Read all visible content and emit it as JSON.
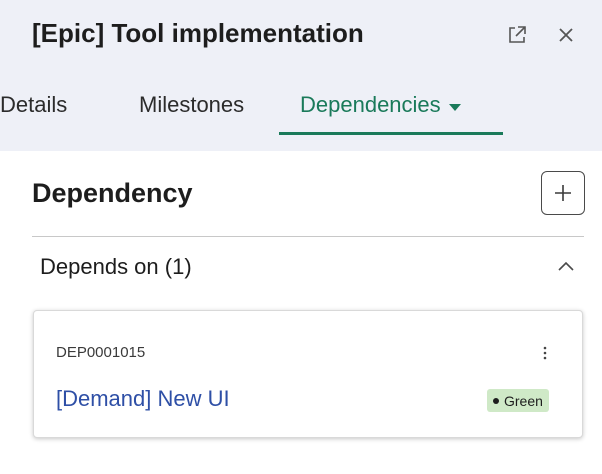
{
  "header": {
    "title": "[Epic] Tool implementation",
    "open_new_window_icon": "external-link-icon",
    "close_icon": "close-icon"
  },
  "tabs": [
    {
      "label": "Details",
      "active": false
    },
    {
      "label": "Milestones",
      "active": false
    },
    {
      "label": "Dependencies",
      "active": true,
      "has_dropdown": true
    }
  ],
  "section": {
    "title": "Dependency",
    "add_icon": "plus-icon"
  },
  "group": {
    "label": "Depends on (1)",
    "expanded": true,
    "toggle_icon": "chevron-up-icon"
  },
  "items": [
    {
      "id": "DEP0001015",
      "title": "[Demand] New UI",
      "status": "Green",
      "menu_icon": "more-vertical-icon"
    }
  ],
  "colors": {
    "header_bg": "#eef0f7",
    "accent": "#1a7a5a",
    "link": "#2e4fa6",
    "status_green_bg": "#cfe9c7"
  }
}
